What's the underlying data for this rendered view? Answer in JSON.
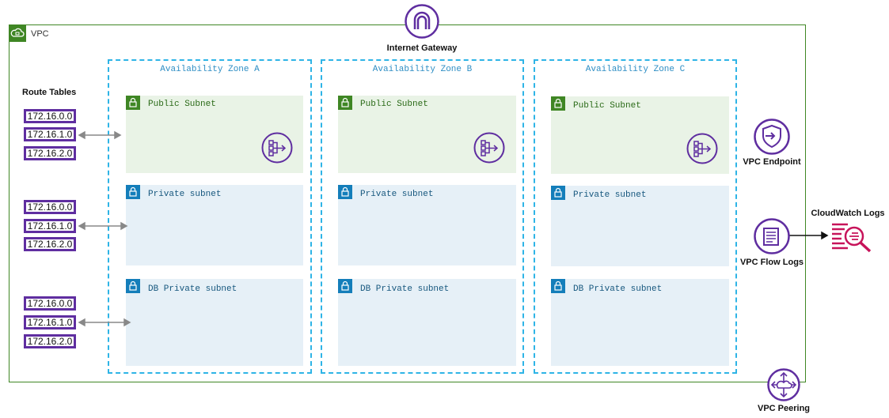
{
  "vpc": {
    "label": "VPC"
  },
  "gateway": {
    "label": "Internet Gateway"
  },
  "route_tables": {
    "title": "Route Tables",
    "groups": [
      [
        "172.16.0.0",
        "172.16.1.0",
        "172.16.2.0"
      ],
      [
        "172.16.0.0",
        "172.16.1.0",
        "172.16.2.0"
      ],
      [
        "172.16.0.0",
        "172.16.1.0",
        "172.16.2.0"
      ]
    ]
  },
  "zones": [
    {
      "label": "Availability Zone A",
      "public": "Public Subnet",
      "private": "Private subnet",
      "db": "DB Private subnet"
    },
    {
      "label": "Availability Zone B",
      "public": "Public Subnet",
      "private": "Private subnet",
      "db": "DB Private subnet"
    },
    {
      "label": "Availability Zone C",
      "public": "Public Subnet",
      "private": "Private subnet",
      "db": "DB Private subnet"
    }
  ],
  "services": {
    "endpoint": "VPC Endpoint",
    "flow_logs": "VPC Flow Logs",
    "cloudwatch": "CloudWatch Logs",
    "peering": "VPC Peering"
  },
  "colors": {
    "vpc_green": "#3f8624",
    "az_blue": "#2eb4e6",
    "service_purple": "#5f2ea0",
    "cloudwatch_pink": "#c7135a"
  }
}
